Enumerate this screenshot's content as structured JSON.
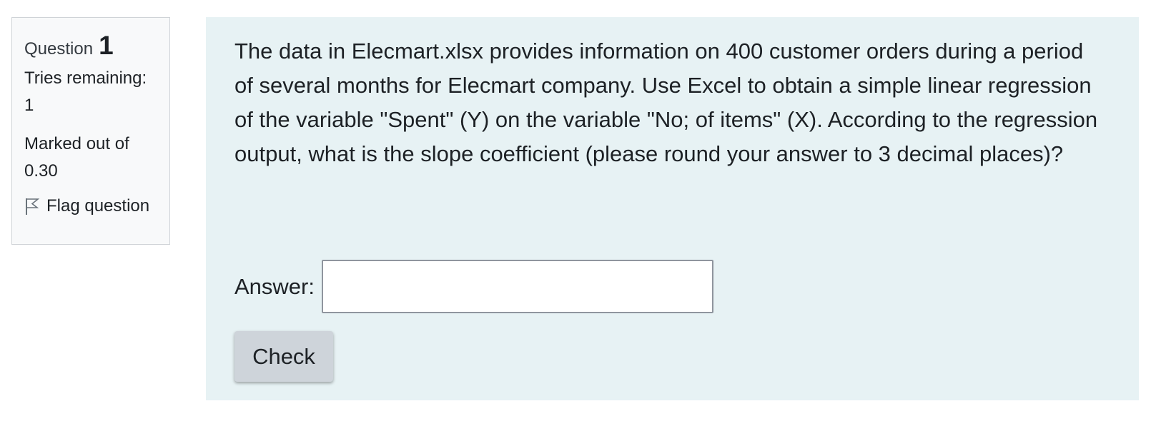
{
  "info": {
    "question_label": "Question",
    "question_number": "1",
    "tries_label": "Tries remaining:",
    "tries_value": "1",
    "marked_label": "Marked out of",
    "marked_value": "0.30",
    "flag_label": "Flag question",
    "flag_icon": "flag-outline-icon"
  },
  "question": {
    "text": "The data in Elecmart.xlsx provides information on 400 customer orders during a period of several months for Elecmart company. Use Excel to obtain a simple linear regression of the variable \"Spent\" (Y) on the variable \"No; of items\" (X). According to the regression output, what is the slope coefficient (please round your answer to 3 decimal places)?",
    "answer_label": "Answer:",
    "answer_value": "",
    "check_label": "Check"
  },
  "colors": {
    "info_bg": "#f8f9fa",
    "content_bg": "#e7f2f4",
    "button_bg": "#ced4da"
  }
}
